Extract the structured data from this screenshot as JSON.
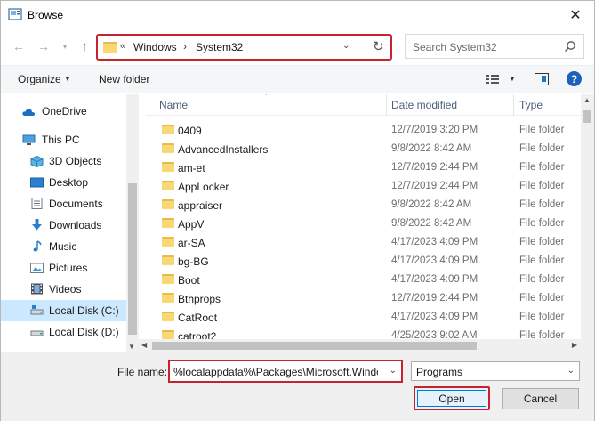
{
  "window": {
    "title": "Browse",
    "close_label": "✕"
  },
  "nav": {
    "address": {
      "crumbs": [
        "Windows",
        "System32"
      ]
    },
    "search_placeholder": "Search System32"
  },
  "toolbar": {
    "organize": "Organize",
    "new_folder": "New folder"
  },
  "sidebar": {
    "items": [
      {
        "label": "OneDrive",
        "icon": "cloud-icon"
      },
      {
        "label": "This PC",
        "icon": "computer-icon"
      },
      {
        "label": "3D Objects",
        "icon": "cube-icon"
      },
      {
        "label": "Desktop",
        "icon": "desktop-icon"
      },
      {
        "label": "Documents",
        "icon": "document-icon"
      },
      {
        "label": "Downloads",
        "icon": "download-arrow-icon"
      },
      {
        "label": "Music",
        "icon": "music-note-icon"
      },
      {
        "label": "Pictures",
        "icon": "picture-icon"
      },
      {
        "label": "Videos",
        "icon": "film-icon"
      },
      {
        "label": "Local Disk (C:)",
        "icon": "drive-icon",
        "selected": true
      },
      {
        "label": "Local Disk (D:)",
        "icon": "drive-icon"
      }
    ]
  },
  "files": {
    "columns": {
      "name": "Name",
      "date": "Date modified",
      "type": "Type"
    },
    "rows": [
      {
        "name": "0409",
        "date": "12/7/2019 3:20 PM",
        "type": "File folder"
      },
      {
        "name": "AdvancedInstallers",
        "date": "9/8/2022 8:42 AM",
        "type": "File folder"
      },
      {
        "name": "am-et",
        "date": "12/7/2019 2:44 PM",
        "type": "File folder"
      },
      {
        "name": "AppLocker",
        "date": "12/7/2019 2:44 PM",
        "type": "File folder"
      },
      {
        "name": "appraiser",
        "date": "9/8/2022 8:42 AM",
        "type": "File folder"
      },
      {
        "name": "AppV",
        "date": "9/8/2022 8:42 AM",
        "type": "File folder"
      },
      {
        "name": "ar-SA",
        "date": "4/17/2023 4:09 PM",
        "type": "File folder"
      },
      {
        "name": "bg-BG",
        "date": "4/17/2023 4:09 PM",
        "type": "File folder"
      },
      {
        "name": "Boot",
        "date": "4/17/2023 4:09 PM",
        "type": "File folder"
      },
      {
        "name": "Bthprops",
        "date": "12/7/2019 2:44 PM",
        "type": "File folder"
      },
      {
        "name": "CatRoot",
        "date": "4/17/2023 4:09 PM",
        "type": "File folder"
      },
      {
        "name": "catroot2",
        "date": "4/25/2023 9:02 AM",
        "type": "File folder"
      }
    ]
  },
  "bottom": {
    "file_name_label": "File name:",
    "file_name_value": "%localappdata%\\Packages\\Microsoft.Window",
    "file_type": "Programs",
    "open": "Open",
    "cancel": "Cancel"
  },
  "colors": {
    "highlight": "#c8232c",
    "selection": "#cce8ff",
    "folder": "#f8d775"
  }
}
